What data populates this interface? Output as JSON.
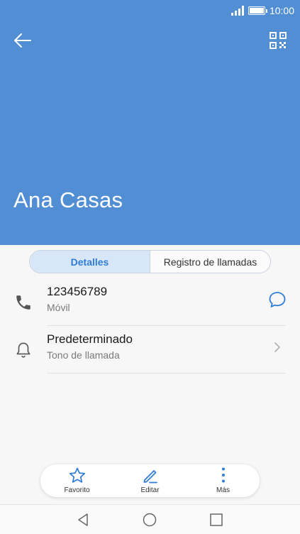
{
  "status": {
    "time": "10:00"
  },
  "contact": {
    "name": "Ana Casas"
  },
  "tabs": [
    {
      "label": "Detalles",
      "active": true
    },
    {
      "label": "Registro de llamadas",
      "active": false
    }
  ],
  "rows": [
    {
      "primary": "123456789",
      "secondary": "Móvil",
      "icon": "phone-icon",
      "action_icon": "message-icon"
    },
    {
      "primary": "Predeterminado",
      "secondary": "Tono de llamada",
      "icon": "bell-icon",
      "action_icon": "chevron-right-icon"
    }
  ],
  "actions": [
    {
      "label": "Favorito",
      "icon": "star-icon"
    },
    {
      "label": "Editar",
      "icon": "pencil-icon"
    },
    {
      "label": "Más",
      "icon": "more-vertical-icon"
    }
  ],
  "colors": {
    "header": "#518ed3",
    "accent": "#2f7dd6"
  }
}
